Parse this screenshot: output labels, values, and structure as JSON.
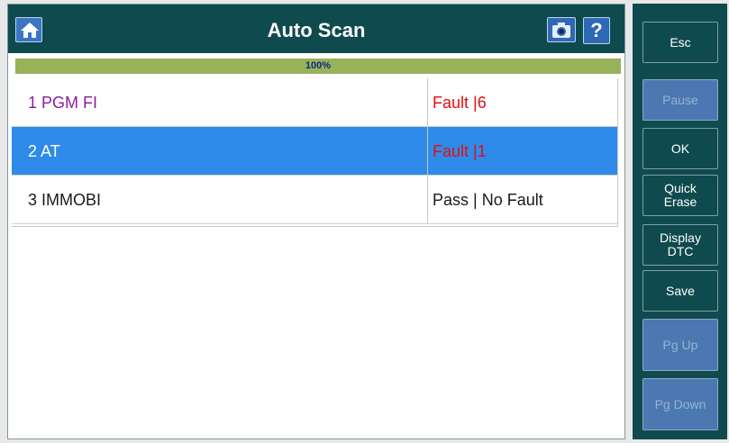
{
  "header": {
    "title": "Auto Scan"
  },
  "progress": {
    "value": 1.0,
    "label": "100%"
  },
  "rows": [
    {
      "index": "1",
      "name": "PGM FI",
      "status": "Fault |6",
      "name_color": "#8a1e9e",
      "status_color": "#e01010",
      "selected": false
    },
    {
      "index": "2",
      "name": "AT",
      "status": "Fault |1",
      "name_color": "#ffffff",
      "status_color": "#e01010",
      "selected": true
    },
    {
      "index": "3",
      "name": "IMMOBI",
      "status": "Pass | No Fault",
      "name_color": "#1a1a1a",
      "status_color": "#1a1a1a",
      "selected": false
    }
  ],
  "side_buttons": [
    {
      "label": "Esc",
      "enabled": true
    },
    {
      "label": "Pause",
      "enabled": false
    },
    {
      "label": "OK",
      "enabled": true
    },
    {
      "label": "Quick Erase",
      "enabled": true
    },
    {
      "label": "Display DTC",
      "enabled": true
    },
    {
      "label": "Save",
      "enabled": true
    },
    {
      "label": "Pg Up",
      "enabled": false
    },
    {
      "label": "Pg Down",
      "enabled": false
    }
  ],
  "icons": {
    "home": "home-icon",
    "camera": "camera-icon",
    "help": "help-icon"
  },
  "help_glyph": "?",
  "colors": {
    "header_bg": "#0f4a4e",
    "progress_bar": "#97b25a",
    "selected_row": "#2f8bea",
    "fault_text": "#e01010",
    "disabled_button": "#4b78b0"
  }
}
